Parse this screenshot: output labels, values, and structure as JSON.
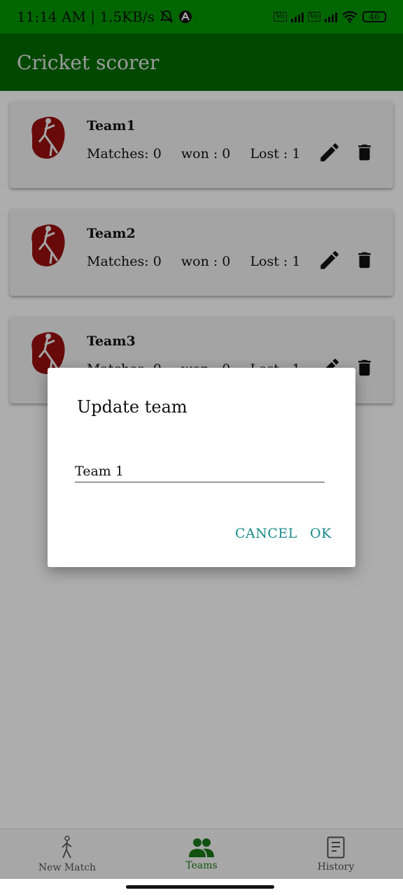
{
  "status_bar": {
    "time": "11:14 AM | 1.5KB/s",
    "battery": "46"
  },
  "app_bar": {
    "title": "Cricket scorer"
  },
  "teams": [
    {
      "name": "Team1",
      "matches": "Matches: 0",
      "won": "won : 0",
      "lost": "Lost : 1"
    },
    {
      "name": "Team2",
      "matches": "Matches: 0",
      "won": "won : 0",
      "lost": "Lost : 1"
    },
    {
      "name": "Team3",
      "matches": "Matches: 0",
      "won": "won : 0",
      "lost": "Lost : 1"
    }
  ],
  "dialog": {
    "title": "Update team",
    "input_value": "Team 1",
    "cancel_label": "CANCEL",
    "ok_label": "OK"
  },
  "bottom_nav": {
    "items": [
      {
        "label": "New Match",
        "icon": "walking-person-icon"
      },
      {
        "label": "Teams",
        "icon": "people-icon",
        "active": true
      },
      {
        "label": "History",
        "icon": "document-icon"
      }
    ]
  },
  "colors": {
    "status_bar": "#009900",
    "app_bar": "#006b00",
    "accent": "#1a8a8a",
    "active_nav": "#1a7a1a"
  }
}
